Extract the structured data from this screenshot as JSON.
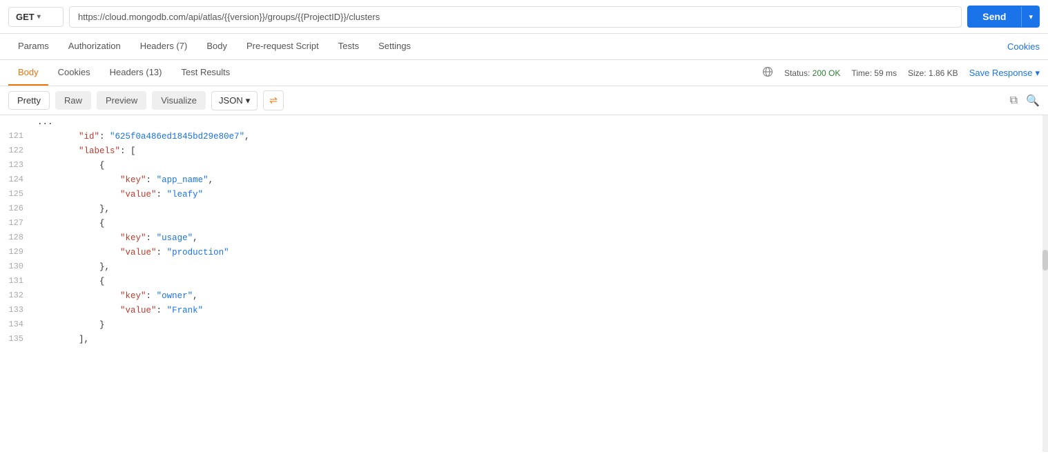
{
  "method": {
    "value": "GET",
    "chevron": "▾"
  },
  "url": {
    "base": "https://cloud.mongodb.com/api/atlas/",
    "part1": "{{version}}",
    "mid": "/groups/",
    "part2": "{{ProjectID}}",
    "end": "/clusters"
  },
  "send_button": {
    "label": "Send",
    "chevron": "▾"
  },
  "request_tabs": [
    {
      "id": "params",
      "label": "Params"
    },
    {
      "id": "authorization",
      "label": "Authorization"
    },
    {
      "id": "headers",
      "label": "Headers (7)"
    },
    {
      "id": "body",
      "label": "Body"
    },
    {
      "id": "prerequest",
      "label": "Pre-request Script"
    },
    {
      "id": "tests",
      "label": "Tests"
    },
    {
      "id": "settings",
      "label": "Settings"
    }
  ],
  "cookies_tab_label": "Cookies",
  "response_tabs": [
    {
      "id": "body",
      "label": "Body",
      "active": true
    },
    {
      "id": "cookies",
      "label": "Cookies"
    },
    {
      "id": "headers",
      "label": "Headers (13)"
    },
    {
      "id": "testresults",
      "label": "Test Results"
    }
  ],
  "response_meta": {
    "status_label": "Status:",
    "status_value": "200 OK",
    "time_label": "Time:",
    "time_value": "59 ms",
    "size_label": "Size:",
    "size_value": "1.86 KB"
  },
  "save_response": "Save Response",
  "viewer_toolbar": {
    "pretty": "Pretty",
    "raw": "Raw",
    "preview": "Preview",
    "visualize": "Visualize",
    "format": "JSON",
    "wrap_icon": "⇌"
  },
  "code_lines": [
    {
      "num": "121",
      "indent": 2,
      "content": "\"id\": \"625f0a486ed1845bd29e80e7\","
    },
    {
      "num": "122",
      "indent": 2,
      "content": "\"labels\": ["
    },
    {
      "num": "123",
      "indent": 3,
      "content": "{"
    },
    {
      "num": "124",
      "indent": 4,
      "content": "\"key\": \"app_name\","
    },
    {
      "num": "125",
      "indent": 4,
      "content": "\"value\": \"leafy\""
    },
    {
      "num": "126",
      "indent": 3,
      "content": "},"
    },
    {
      "num": "127",
      "indent": 3,
      "content": "{"
    },
    {
      "num": "128",
      "indent": 4,
      "content": "\"key\": \"usage\","
    },
    {
      "num": "129",
      "indent": 4,
      "content": "\"value\": \"production\""
    },
    {
      "num": "130",
      "indent": 3,
      "content": "},"
    },
    {
      "num": "131",
      "indent": 3,
      "content": "{"
    },
    {
      "num": "132",
      "indent": 4,
      "content": "\"key\": \"owner\","
    },
    {
      "num": "133",
      "indent": 4,
      "content": "\"value\": \"Frank\""
    },
    {
      "num": "134",
      "indent": 3,
      "content": "}"
    },
    {
      "num": "135",
      "indent": 2,
      "content": "],"
    }
  ]
}
